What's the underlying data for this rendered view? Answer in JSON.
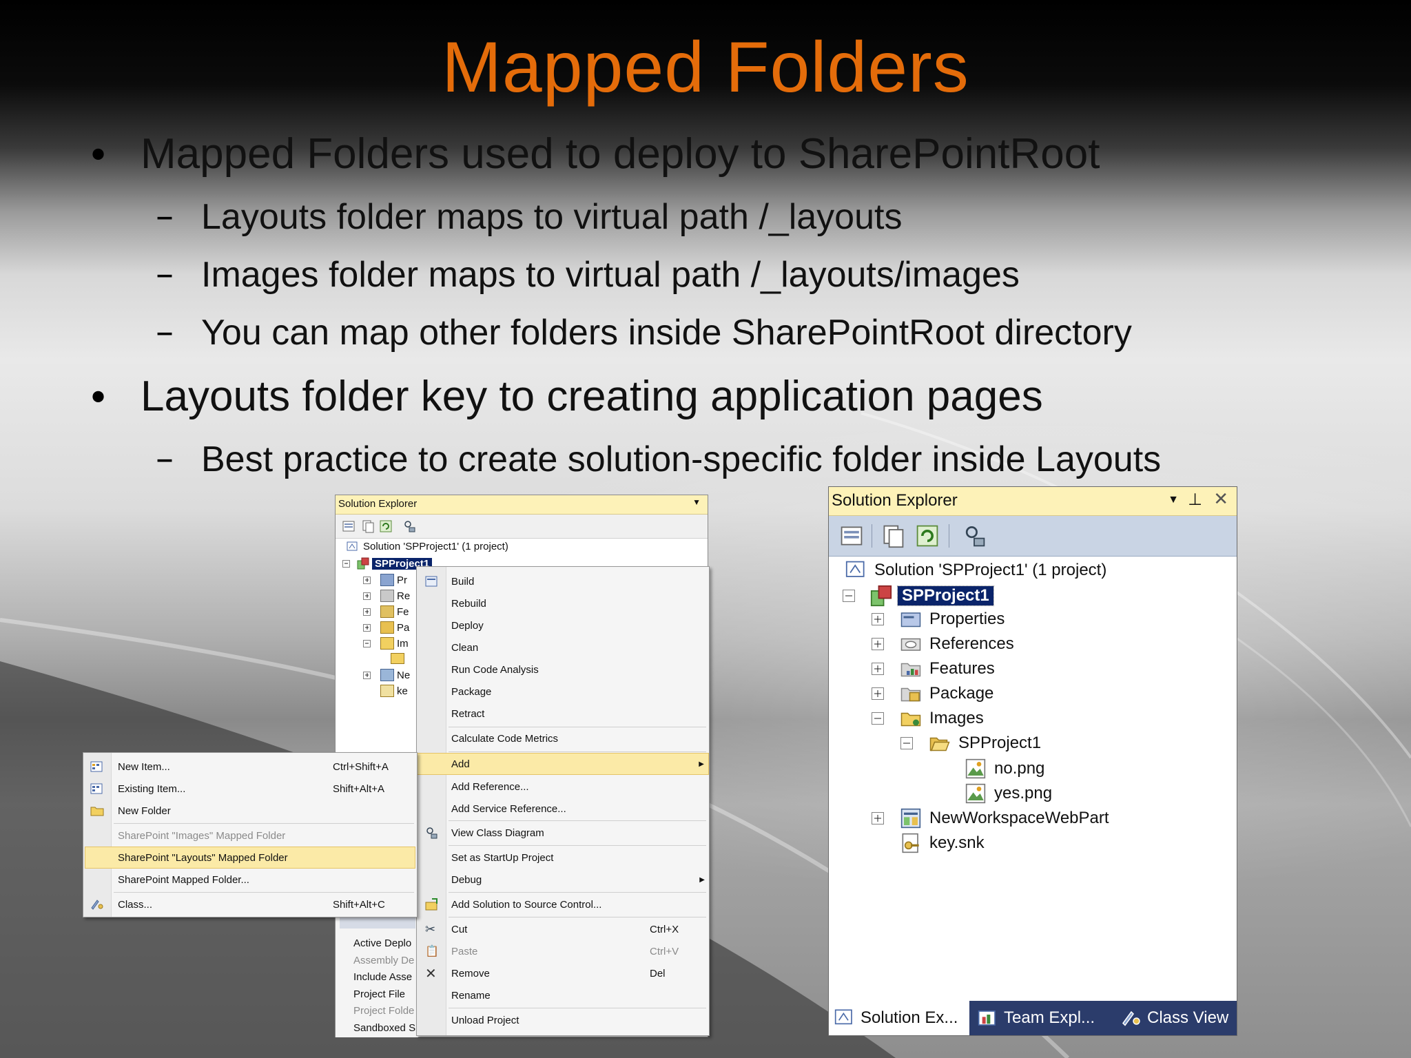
{
  "slide": {
    "title": "Mapped Folders",
    "bullets": [
      {
        "text": "Mapped Folders used to deploy to SharePointRoot",
        "level": 1
      },
      {
        "text": "Layouts folder maps to virtual path /_layouts",
        "level": 2
      },
      {
        "text": "Images folder maps to virtual path /_layouts/images",
        "level": 2
      },
      {
        "text": "You can map other folders inside SharePointRoot directory",
        "level": 2
      },
      {
        "text": "Layouts folder key to creating application pages",
        "level": 1
      },
      {
        "text": "Best practice to create solution-specific folder inside Layouts",
        "level": 2
      }
    ],
    "bullet_glyph": "•",
    "dash_glyph": "–"
  },
  "left_explorer": {
    "title": "Solution Explorer",
    "solution": "Solution 'SPProject1' (1 project)",
    "project": "SPProject1",
    "stubs": [
      "Pr",
      "Re",
      "Fe",
      "Pa",
      "Im",
      "",
      "Ne",
      "ke"
    ],
    "props_rows": [
      "Active Deplo",
      "Assembly De",
      "Include Asse",
      "Project File",
      "Project Folde",
      "Sandboxed S"
    ]
  },
  "context_menu": {
    "items": [
      {
        "label": "Build",
        "shortcut": ""
      },
      {
        "label": "Rebuild",
        "shortcut": ""
      },
      {
        "label": "Deploy",
        "shortcut": ""
      },
      {
        "label": "Clean",
        "shortcut": ""
      },
      {
        "label": "Run Code Analysis",
        "shortcut": ""
      },
      {
        "label": "Package",
        "shortcut": ""
      },
      {
        "label": "Retract",
        "shortcut": ""
      },
      {
        "label": "Calculate Code Metrics",
        "shortcut": ""
      },
      {
        "label": "Add",
        "shortcut": ""
      },
      {
        "label": "Add Reference...",
        "shortcut": ""
      },
      {
        "label": "Add Service Reference...",
        "shortcut": ""
      },
      {
        "label": "View Class Diagram",
        "shortcut": ""
      },
      {
        "label": "Set as StartUp Project",
        "shortcut": ""
      },
      {
        "label": "Debug",
        "shortcut": ""
      },
      {
        "label": "Add Solution to Source Control...",
        "shortcut": ""
      },
      {
        "label": "Cut",
        "shortcut": "Ctrl+X"
      },
      {
        "label": "Paste",
        "shortcut": "Ctrl+V"
      },
      {
        "label": "Remove",
        "shortcut": "Del"
      },
      {
        "label": "Rename",
        "shortcut": ""
      },
      {
        "label": "Unload Project",
        "shortcut": ""
      }
    ]
  },
  "add_submenu": {
    "items": [
      {
        "label": "New Item...",
        "shortcut": "Ctrl+Shift+A"
      },
      {
        "label": "Existing Item...",
        "shortcut": "Shift+Alt+A"
      },
      {
        "label": "New Folder",
        "shortcut": ""
      },
      {
        "label": "SharePoint \"Images\" Mapped Folder",
        "shortcut": ""
      },
      {
        "label": "SharePoint \"Layouts\" Mapped Folder",
        "shortcut": ""
      },
      {
        "label": "SharePoint Mapped Folder...",
        "shortcut": ""
      },
      {
        "label": "Class...",
        "shortcut": "Shift+Alt+C"
      }
    ]
  },
  "right_explorer": {
    "title": "Solution Explorer",
    "solution": "Solution 'SPProject1' (1 project)",
    "project": "SPProject1",
    "items": [
      "Properties",
      "References",
      "Features",
      "Package",
      "Images",
      "SPProject1",
      "no.png",
      "yes.png",
      "NewWorkspaceWebPart",
      "key.snk"
    ],
    "tabs": [
      "Solution Ex...",
      "Team Expl...",
      "Class View"
    ]
  },
  "colors": {
    "title_orange": "#e46c0a",
    "pane_title_bg": "#fdf2b8",
    "toolbar_bg": "#c9d4e4",
    "selection_bg": "#0a246a",
    "highlight_bg": "#fbeaa7",
    "tab_bar_bg": "#2b3c6b"
  }
}
